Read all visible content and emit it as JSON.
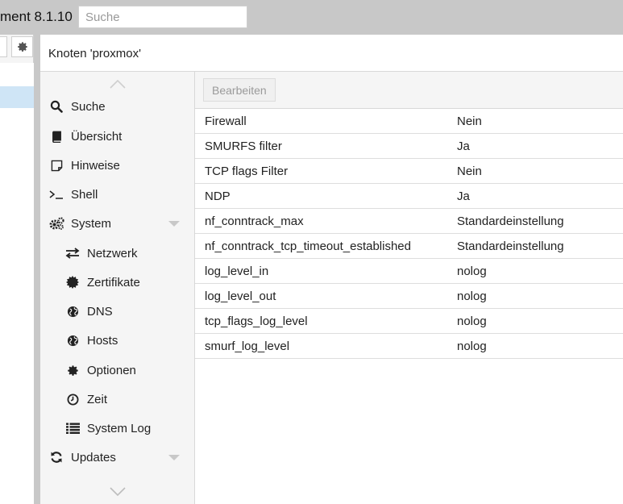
{
  "app": {
    "title": "ment 8.1.10"
  },
  "search": {
    "placeholder": "Suche"
  },
  "panel": {
    "title": "Knoten 'proxmox'"
  },
  "nav": {
    "items": [
      {
        "label": "Suche",
        "icon": "search-icon"
      },
      {
        "label": "Übersicht",
        "icon": "book-icon"
      },
      {
        "label": "Hinweise",
        "icon": "note-icon"
      },
      {
        "label": "Shell",
        "icon": "terminal-icon"
      },
      {
        "label": "System",
        "icon": "cogs-icon"
      },
      {
        "label": "Netzwerk",
        "icon": "exchange-icon"
      },
      {
        "label": "Zertifikate",
        "icon": "certificate-icon"
      },
      {
        "label": "DNS",
        "icon": "globe-icon"
      },
      {
        "label": "Hosts",
        "icon": "globe-icon"
      },
      {
        "label": "Optionen",
        "icon": "gear-icon"
      },
      {
        "label": "Zeit",
        "icon": "clock-icon"
      },
      {
        "label": "System Log",
        "icon": "list-icon"
      },
      {
        "label": "Updates",
        "icon": "refresh-icon"
      }
    ]
  },
  "toolbar": {
    "edit_label": "Bearbeiten"
  },
  "grid": {
    "rows": [
      {
        "key": "Firewall",
        "value": "Nein"
      },
      {
        "key": "SMURFS filter",
        "value": "Ja"
      },
      {
        "key": "TCP flags Filter",
        "value": "Nein"
      },
      {
        "key": "NDP",
        "value": "Ja"
      },
      {
        "key": "nf_conntrack_max",
        "value": "Standardeinstellung"
      },
      {
        "key": "nf_conntrack_tcp_timeout_established",
        "value": "Standardeinstellung"
      },
      {
        "key": "log_level_in",
        "value": "nolog"
      },
      {
        "key": "log_level_out",
        "value": "nolog"
      },
      {
        "key": "tcp_flags_log_level",
        "value": "nolog"
      },
      {
        "key": "smurf_log_level",
        "value": "nolog"
      }
    ]
  },
  "colors": {
    "selected": "#cfe5f6",
    "topbar": "#c8c8c8",
    "disabled_text": "#9a9a9a"
  }
}
